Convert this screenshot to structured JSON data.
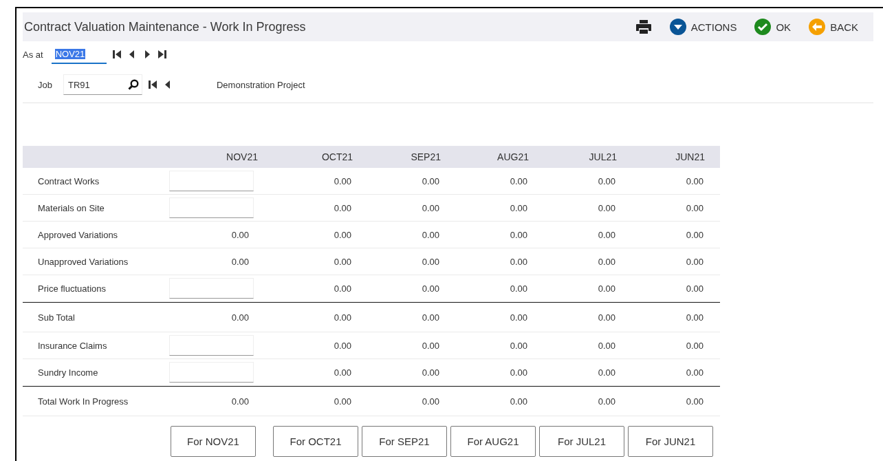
{
  "window": {
    "title": "Contract Valuation Maintenance - Work In Progress"
  },
  "toolbar": [
    {
      "kind": "print"
    },
    {
      "kind": "actions",
      "label": "ACTIONS"
    },
    {
      "kind": "ok",
      "label": "OK"
    },
    {
      "kind": "back",
      "label": "BACK"
    }
  ],
  "as_at": {
    "label": "As at",
    "value": "NOV21",
    "text_selected": true,
    "nav": [
      {
        "kind": "first"
      },
      {
        "kind": "prev"
      },
      {
        "kind": "next"
      },
      {
        "kind": "last"
      }
    ]
  },
  "job": {
    "label": "Job",
    "value": "TR91",
    "nav": [
      {
        "kind": "first"
      },
      {
        "kind": "prev"
      }
    ],
    "description": "Demonstration Project"
  },
  "table": {
    "columns": [
      "NOV21",
      "OCT21",
      "SEP21",
      "AUG21",
      "JUL21",
      "JUN21"
    ],
    "rows": [
      {
        "label": "Contract Works",
        "kind": "input",
        "separator_before": false,
        "values": [
          "0.00",
          "0.00",
          "0.00",
          "0.00",
          "0.00"
        ]
      },
      {
        "label": "Materials on Site",
        "kind": "input",
        "separator_before": false,
        "values": [
          "0.00",
          "0.00",
          "0.00",
          "0.00",
          "0.00"
        ]
      },
      {
        "label": "Approved Variations",
        "kind": "value",
        "separator_before": false,
        "values": [
          "0.00",
          "0.00",
          "0.00",
          "0.00",
          "0.00",
          "0.00"
        ]
      },
      {
        "label": "Unapproved Variations",
        "kind": "value",
        "separator_before": false,
        "values": [
          "0.00",
          "0.00",
          "0.00",
          "0.00",
          "0.00",
          "0.00"
        ]
      },
      {
        "label": "Price fluctuations",
        "kind": "input",
        "separator_before": false,
        "values": [
          "0.00",
          "0.00",
          "0.00",
          "0.00",
          "0.00"
        ]
      },
      {
        "label": "Sub Total",
        "kind": "value",
        "separator_before": true,
        "values": [
          "0.00",
          "0.00",
          "0.00",
          "0.00",
          "0.00",
          "0.00"
        ]
      },
      {
        "label": "Insurance Claims",
        "kind": "input",
        "separator_before": false,
        "values": [
          "0.00",
          "0.00",
          "0.00",
          "0.00",
          "0.00"
        ]
      },
      {
        "label": "Sundry Income",
        "kind": "input",
        "separator_before": false,
        "values": [
          "0.00",
          "0.00",
          "0.00",
          "0.00",
          "0.00"
        ]
      },
      {
        "label": "Total Work In Progress",
        "kind": "value",
        "separator_before": true,
        "values": [
          "0.00",
          "0.00",
          "0.00",
          "0.00",
          "0.00",
          "0.00"
        ]
      }
    ]
  },
  "period_buttons": [
    "For NOV21",
    "For OCT21",
    "For SEP21",
    "For AUG21",
    "For JUL21",
    "For JUN21"
  ]
}
